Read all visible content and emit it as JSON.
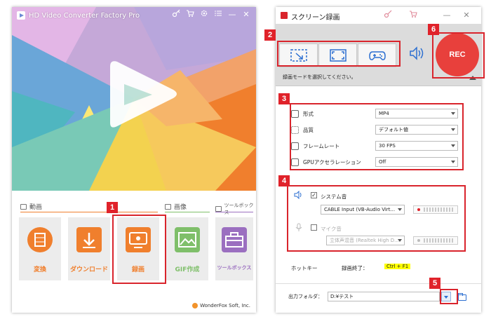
{
  "colors": {
    "accent_red": "#d9242c",
    "rec_red": "#e8403c",
    "hotkey_yellow": "#ffff00"
  },
  "left": {
    "title": "HD Video Converter Factory Pro",
    "title_icons": [
      "key-icon",
      "cart-icon",
      "gear-icon",
      "list-icon"
    ],
    "minimize": "—",
    "close": "✕",
    "sections": {
      "video": "動画",
      "image": "画像",
      "toolbox": "ツールボックス"
    },
    "tiles": {
      "convert": "変換",
      "download": "ダウンロード",
      "record": "録画",
      "gif": "GIF作成",
      "toolbox": "ツールボックス"
    },
    "footer": "WonderFox Soft, Inc."
  },
  "right": {
    "title": "スクリーン録画",
    "minimize": "—",
    "close": "✕",
    "rec": "REC",
    "mode_text": "録画モードを選択してください。",
    "options": {
      "format_label": "形式",
      "format_value": "MP4",
      "quality_label": "品質",
      "quality_value": "デフォルト値",
      "framerate_label": "フレームレート",
      "framerate_value": "30 FPS",
      "gpu_label": "GPUアクセラレーション",
      "gpu_value": "Off"
    },
    "audio": {
      "system_label": "システム音",
      "system_device": "CABLE Input (VB-Audio Virt...",
      "mic_label": "マイク音",
      "mic_device": "立体声混音 (Realtek High D..."
    },
    "hotkey_label": "ホットキー",
    "hotkey_end_label": "録画終了：",
    "hotkey_value": "Ctrl + F1",
    "output_label": "出力フォルダ：",
    "output_path": "D:¥テスト"
  },
  "badges": [
    "1",
    "2",
    "3",
    "4",
    "5",
    "6"
  ]
}
